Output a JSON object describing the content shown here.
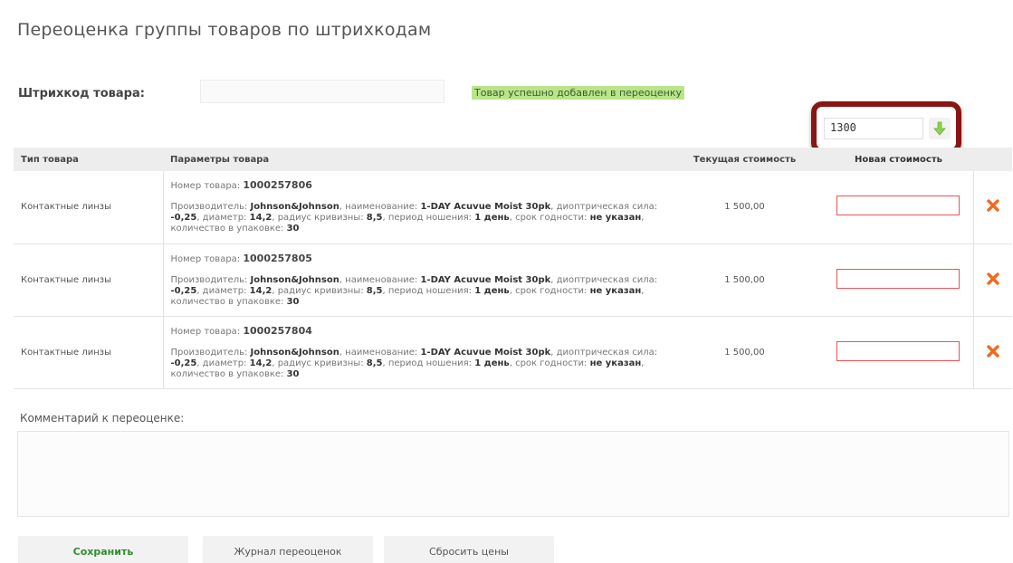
{
  "page": {
    "title": "Переоценка группы товаров по штрихкодам"
  },
  "barcode": {
    "label": "Штрихкод товара:",
    "value": "",
    "success_message": "Товар успешно добавлен в переоценку"
  },
  "bulk_price": {
    "value": "1300",
    "apply_icon": "arrow-down-icon",
    "highlight_color": "#8b1414"
  },
  "table": {
    "headers": {
      "type": "Тип товара",
      "params": "Параметры товара",
      "current_cost": "Текущая стоимость",
      "new_cost": "Новая стоимость"
    },
    "rows": [
      {
        "type": "Контактные линзы",
        "number_label": "Номер товара:",
        "number": "1000257806",
        "l_manufacturer": "Производитель:",
        "manufacturer": "Johnson&Johnson",
        "l_name": ", наименование:",
        "name": "1-DAY Acuvue Moist 30pk",
        "l_power": ", диоптрическая сила:",
        "power": "-0,25",
        "l_diameter": ", диаметр:",
        "diameter": "14,2",
        "l_radius": ", радиус кривизны:",
        "radius": "8,5",
        "l_period": ", период ношения:",
        "period": "1 день",
        "l_expiry": ", срок годности:",
        "expiry": "не указан",
        "l_qty": ", количество в упаковке:",
        "qty": "30",
        "current_cost": "1 500,00",
        "new_cost": ""
      },
      {
        "type": "Контактные линзы",
        "number_label": "Номер товара:",
        "number": "1000257805",
        "l_manufacturer": "Производитель:",
        "manufacturer": "Johnson&Johnson",
        "l_name": ", наименование:",
        "name": "1-DAY Acuvue Moist 30pk",
        "l_power": ", диоптрическая сила:",
        "power": "-0,25",
        "l_diameter": ", диаметр:",
        "diameter": "14,2",
        "l_radius": ", радиус кривизны:",
        "radius": "8,5",
        "l_period": ", период ношения:",
        "period": "1 день",
        "l_expiry": ", срок годности:",
        "expiry": "не указан",
        "l_qty": ", количество в упаковке:",
        "qty": "30",
        "current_cost": "1 500,00",
        "new_cost": ""
      },
      {
        "type": "Контактные линзы",
        "number_label": "Номер товара:",
        "number": "1000257804",
        "l_manufacturer": "Производитель:",
        "manufacturer": "Johnson&Johnson",
        "l_name": ", наименование:",
        "name": "1-DAY Acuvue Moist 30pk",
        "l_power": ", диоптрическая сила:",
        "power": "-0,25",
        "l_diameter": ", диаметр:",
        "diameter": "14,2",
        "l_radius": ", радиус кривизны:",
        "radius": "8,5",
        "l_period": ", период ношения:",
        "period": "1 день",
        "l_expiry": ", срок годности:",
        "expiry": "не указан",
        "l_qty": ", количество в упаковке:",
        "qty": "30",
        "current_cost": "1 500,00",
        "new_cost": ""
      }
    ],
    "delete_icon": "close-x-icon",
    "delete_color": "#f06a23",
    "invalid_border_color": "#e9555a"
  },
  "comment": {
    "label": "Комментарий к переоценке:",
    "value": ""
  },
  "buttons": {
    "save": "Сохранить",
    "journal": "Журнал переоценок",
    "reset": "Сбросить цены"
  }
}
